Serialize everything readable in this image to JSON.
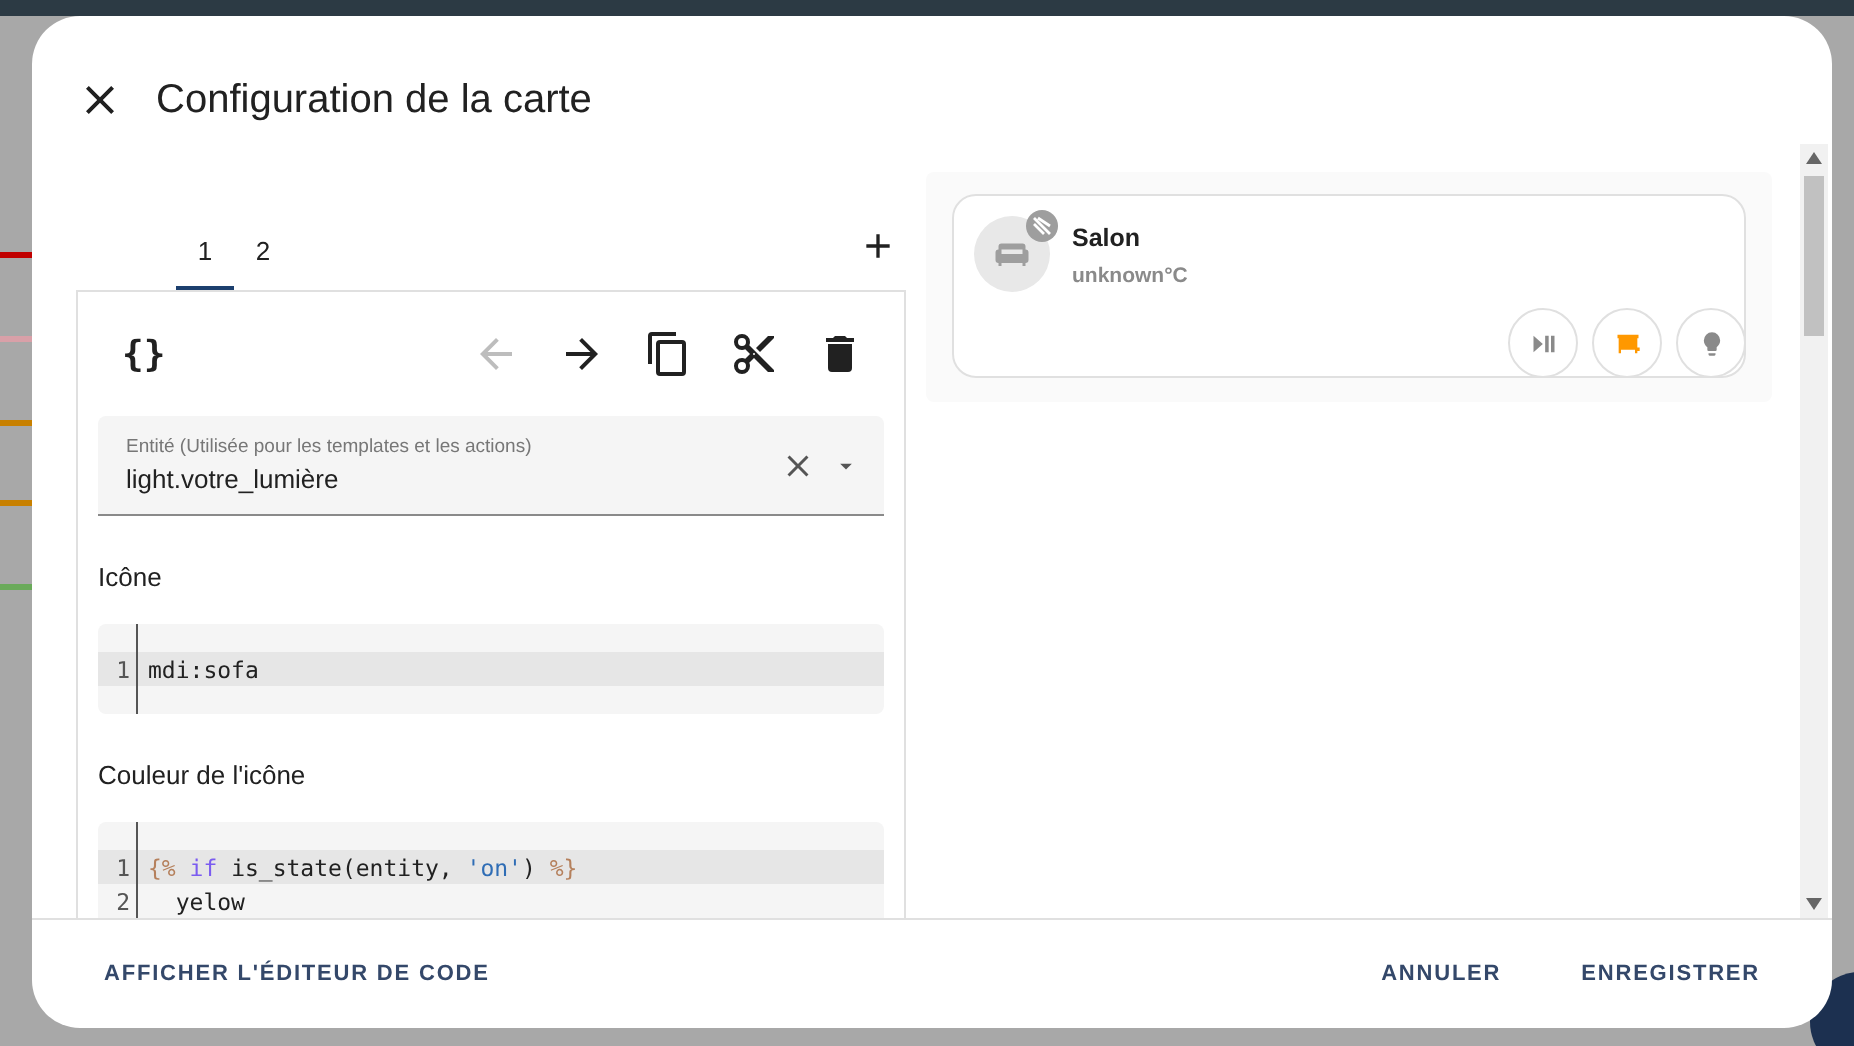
{
  "dialog": {
    "title": "Configuration de la carte"
  },
  "tabs": [
    {
      "label": "1",
      "selected": true
    },
    {
      "label": "2",
      "selected": false
    }
  ],
  "code_toggle": "{}",
  "toolbar": [
    {
      "kind": "back",
      "disabled": true
    },
    {
      "kind": "forward",
      "disabled": false
    },
    {
      "kind": "copy",
      "disabled": false
    },
    {
      "kind": "cut",
      "disabled": false
    },
    {
      "kind": "delete",
      "disabled": false
    }
  ],
  "entity_field": {
    "label": "Entité (Utilisée pour les templates et les actions)",
    "value": "light.votre_lumière"
  },
  "sections": [
    {
      "label": "Icône",
      "lines": [
        {
          "number": "1",
          "active": true,
          "tokens": [
            {
              "kind": "plain",
              "text": "mdi:sofa"
            }
          ]
        }
      ]
    },
    {
      "label": "Couleur de l'icône",
      "lines": [
        {
          "number": "1",
          "active": true,
          "tokens": [
            {
              "kind": "delim",
              "text": "{%"
            },
            {
              "kind": "keyword",
              "text": " if"
            },
            {
              "kind": "plain",
              "text": " is_state(entity, "
            },
            {
              "kind": "string",
              "text": "'on'"
            },
            {
              "kind": "plain",
              "text": ") "
            },
            {
              "kind": "delim",
              "text": "%}"
            }
          ]
        },
        {
          "number": "2",
          "active": false,
          "tokens": [
            {
              "kind": "plain",
              "text": "  yelow"
            }
          ]
        }
      ]
    }
  ],
  "preview": {
    "name": "Salon",
    "state": "unknown°C",
    "buttons": [
      {
        "kind": "media",
        "active": false
      },
      {
        "kind": "blind",
        "active": true
      },
      {
        "kind": "bulb",
        "active": false
      }
    ]
  },
  "footer": {
    "left": "AFFICHER L'ÉDITEUR DE CODE",
    "buttons": [
      "ANNULER",
      "ENREGISTRER"
    ]
  }
}
